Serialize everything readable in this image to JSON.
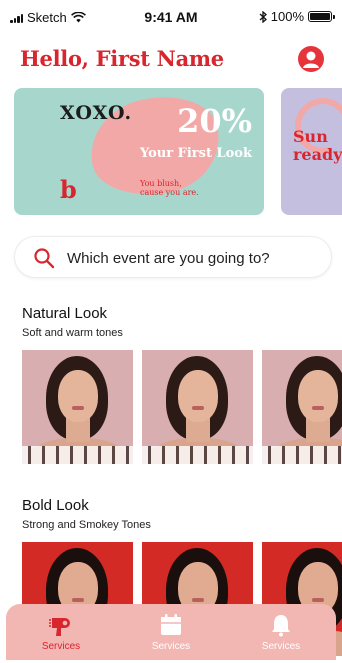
{
  "status_bar": {
    "carrier": "Sketch",
    "time": "9:41 AM",
    "battery": "100%"
  },
  "header": {
    "greeting": "Hello, First Name"
  },
  "promos": [
    {
      "brand": "XOXO.",
      "discount": "20%",
      "subtitle": "Your First Look",
      "logo": "b",
      "tagline_line1": "You blush,",
      "tagline_line2": "cause you are.",
      "background": "#a7d7cc"
    },
    {
      "text_line1": "Sun",
      "text_line2": "ready",
      "background": "#c5bfdf"
    }
  ],
  "search": {
    "placeholder": "Which event are you going to?"
  },
  "sections": [
    {
      "title": "Natural Look",
      "subtitle": "Soft and warm tones"
    },
    {
      "title": "Bold Look",
      "subtitle": "Strong and Smokey Tones"
    }
  ],
  "bottom_nav": {
    "items": [
      {
        "label": "Services",
        "icon": "hair-dryer-icon",
        "active": true
      },
      {
        "label": "Services",
        "icon": "calendar-icon",
        "active": false
      },
      {
        "label": "Services",
        "icon": "bell-icon",
        "active": false
      }
    ]
  },
  "colors": {
    "accent": "#d8262e",
    "nav_bg": "#f2b6b3"
  }
}
